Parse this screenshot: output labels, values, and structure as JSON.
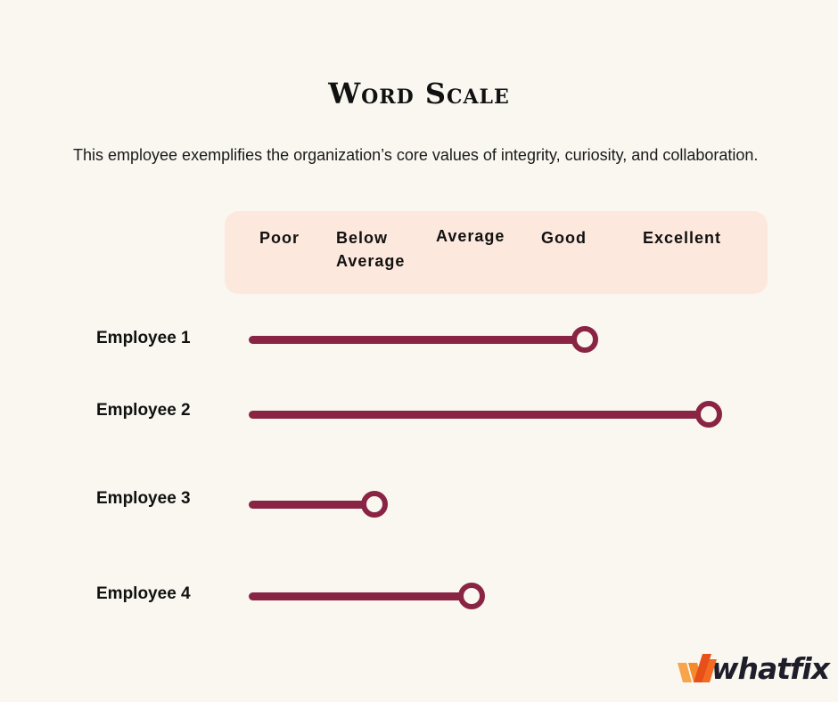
{
  "title": "Word Scale",
  "description": "This employee exemplifies the organization’s core values of integrity, curiosity, and collaboration.",
  "scale": {
    "labels": [
      "Poor",
      "Below Average",
      "Average",
      "Good",
      "Excellent"
    ],
    "label_lines": [
      [
        "Poor"
      ],
      [
        "Below",
        "Average"
      ],
      [
        "Average"
      ],
      [
        "Good"
      ],
      [
        "Excellent"
      ]
    ]
  },
  "employees": [
    {
      "name": "Employee 1",
      "rating": "Good",
      "rating_index": 3
    },
    {
      "name": "Employee 2",
      "rating": "Excellent",
      "rating_index": 4
    },
    {
      "name": "Employee 3",
      "rating": "Below Average",
      "rating_index": 1
    },
    {
      "name": "Employee 4",
      "rating": "Average",
      "rating_index": 2
    }
  ],
  "colors": {
    "track": "#8a2444",
    "header_bg": "#fde8dd",
    "page_bg": "#f9f7f0"
  },
  "brand": {
    "name": "whatfix",
    "icon": "whatfix-logo-icon"
  }
}
